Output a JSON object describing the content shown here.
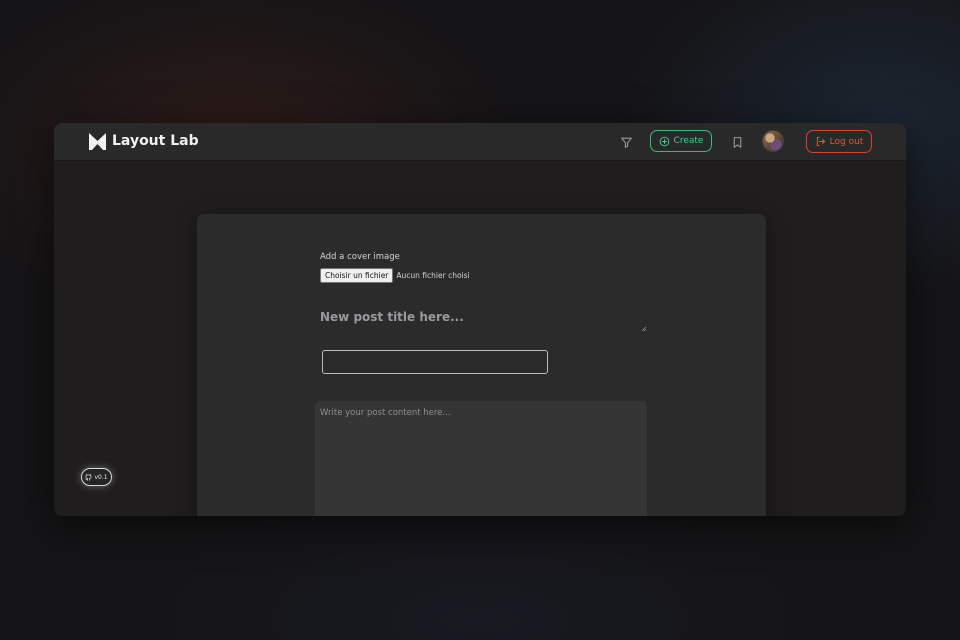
{
  "brand": {
    "name": "Layout Lab",
    "logo_icon": "layout-lab-logo-icon"
  },
  "navbar": {
    "filter_icon": "filter-icon",
    "create_label": "Create",
    "create_icon": "plus-circle-icon",
    "bookmark_icon": "bookmark-icon",
    "logout_label": "Log out",
    "logout_icon": "logout-icon"
  },
  "editor": {
    "cover_label": "Add a cover image",
    "file_button_label": "Choisir un fichier",
    "file_status": "Aucun fichier choisi",
    "title_placeholder": "New post title here...",
    "tags_value": "",
    "content_placeholder": "Write your post content here..."
  },
  "version": {
    "label": "v0.1",
    "icon": "github-icon"
  },
  "colors": {
    "create_accent": "#3fd08a",
    "logout_accent": "#e0553f",
    "navbar_bg": "#2a2929",
    "card_bg": "#2c2b2b"
  }
}
